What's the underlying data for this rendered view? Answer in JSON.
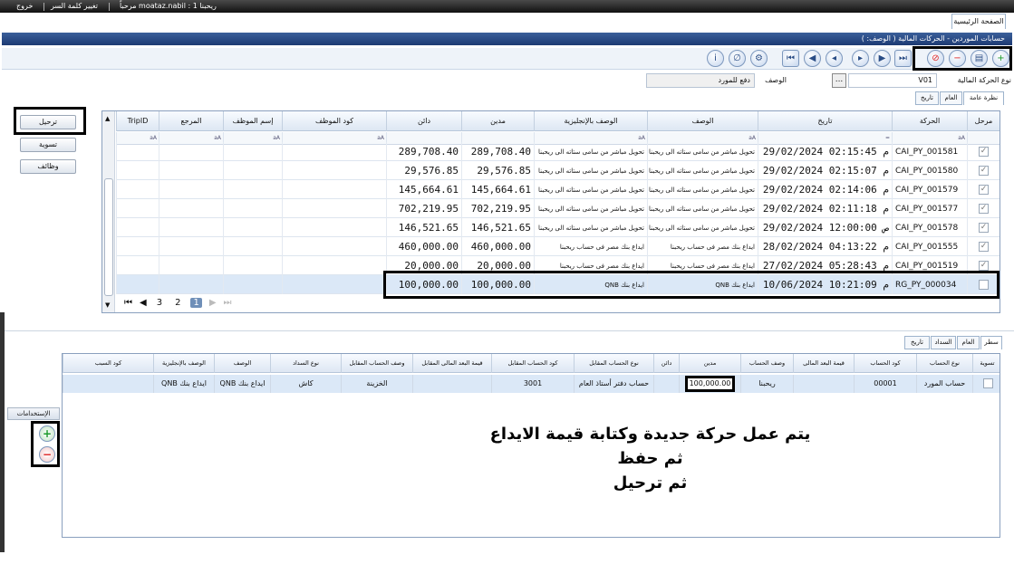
{
  "topbar": {
    "exit": "خروج",
    "change_password": "تغيير كلمة السر",
    "greeting": "مرحباً moataz.nabil : ريحبنا 1"
  },
  "tabs": {
    "home": "الصفحة الرئيسية"
  },
  "breadcrumb": "حسابات الموردين - الحركات المالية  ( الوصف: )",
  "toolbar_icons": [
    "add-icon",
    "save-icon",
    "delete-icon",
    "cancel-icon",
    "last-icon",
    "next-icon",
    "next-page-icon",
    "prev-page-icon",
    "prev-icon",
    "first-icon",
    "settings-icon",
    "attach-icon",
    "info-icon"
  ],
  "filters": {
    "movement_type_label": "نوع الحركة المالية",
    "movement_type_value": "V01",
    "description_label": "الوصف",
    "description_value": "دفع للمورد",
    "lookup_button": "..."
  },
  "subtabs_top": {
    "overview": "نظرة عامة",
    "general": "العام",
    "history": "تاريخ"
  },
  "left_buttons": {
    "post": "ترحيل",
    "settle": "تسوية",
    "functions": "وظائف"
  },
  "grid1": {
    "columns": [
      "مرحل",
      "الحركة",
      "تاريخ",
      "الوصف",
      "الوصف بالإنجليزية",
      "مدين",
      "دائن",
      "كود الموظف",
      "إسم الموظف",
      "المرجع",
      "TripID"
    ],
    "filter_glyph": "aA",
    "date_filter_glyph": "=",
    "rows": [
      {
        "posted": true,
        "code": "CAI_PY_001581",
        "date": "29/02/2024 02:15:45 م",
        "desc": "تحويل مباشر من سامى ستاته الى ريحبنا",
        "desc_en": "تحويل مباشر من سامى ستاته الى ريحبنا",
        "debit": "289,708.40",
        "credit": "289,708.40"
      },
      {
        "posted": true,
        "code": "CAI_PY_001580",
        "date": "29/02/2024 02:15:07 م",
        "desc": "تحويل مباشر من سامى ستاته الى ريحبنا",
        "desc_en": "تحويل مباشر من سامى ستاته الى ريحبنا",
        "debit": "29,576.85",
        "credit": "29,576.85"
      },
      {
        "posted": true,
        "code": "CAI_PY_001579",
        "date": "29/02/2024 02:14:06 م",
        "desc": "تحويل مباشر من سامى ستاته الى ريحبنا",
        "desc_en": "تحويل مباشر من سامى ستاته الى ريحبنا",
        "debit": "145,664.61",
        "credit": "145,664.61"
      },
      {
        "posted": true,
        "code": "CAI_PY_001577",
        "date": "29/02/2024 02:11:18 م",
        "desc": "تحويل مباشر من سامى ستاته الى ريحبنا",
        "desc_en": "تحويل مباشر من سامى ستاته الى ريحبنا",
        "debit": "702,219.95",
        "credit": "702,219.95"
      },
      {
        "posted": true,
        "code": "CAI_PY_001578",
        "date": "29/02/2024 12:00:00 ص",
        "desc": "تحويل مباشر من سامى ستاته الى ريحبنا",
        "desc_en": "تحويل مباشر من سامى ستاته الى ريحبنا",
        "debit": "146,521.65",
        "credit": "146,521.65"
      },
      {
        "posted": true,
        "code": "CAI_PY_001555",
        "date": "28/02/2024 04:13:22 م",
        "desc": "ايداع بنك مصر فى حساب ريحبنا",
        "desc_en": "ايداع بنك مصر فى حساب ريحبنا",
        "debit": "460,000.00",
        "credit": "460,000.00"
      },
      {
        "posted": true,
        "code": "CAI_PY_001519",
        "date": "27/02/2024 05:28:43 م",
        "desc": "ايداع بنك مصر فى حساب ريحبنا",
        "desc_en": "ايداع بنك مصر فى حساب ريحبنا",
        "debit": "20,000.00",
        "credit": "20,000.00"
      },
      {
        "posted": false,
        "code": "RG_PY_000034",
        "date": "10/06/2024 10:21:09 م",
        "desc": "ايداع بنك QNB",
        "desc_en": "ايداع بنك QNB",
        "debit": "100,000.00",
        "credit": "100,000.00"
      }
    ],
    "pager": {
      "first": "⏮",
      "prev": "◀",
      "pages": [
        "3",
        "2",
        "1"
      ],
      "current": "1",
      "next": "▶",
      "last": "⏭"
    }
  },
  "subtabs_bottom": {
    "lines": "سطر",
    "general": "العام",
    "payment": "السداد",
    "history": "تاريخ"
  },
  "uses": {
    "label": "الإستخدامات"
  },
  "grid2": {
    "columns": [
      "تسوية",
      "نوع الحساب",
      "كود الحساب",
      "قيمة البعد المالى",
      "وصف الحساب",
      "مدين",
      "دائن",
      "نوع الحساب المقابل",
      "كود الحساب المقابل",
      "قيمة البعد المالى المقابل",
      "وصف الحساب المقابل",
      "نوع السداد",
      "الوصف",
      "الوصف بالإنجليزية",
      "كود السبب"
    ],
    "row": {
      "account_type": "حساب المورد",
      "account_code": "00001",
      "fin_dim": "",
      "account_desc": "ريحبنا",
      "debit": "100,000.00",
      "credit": "",
      "offset_type": "حساب دفتر أستاذ العام",
      "offset_code": "3001",
      "offset_dim": "",
      "offset_desc": "الخزينة",
      "payment_type": "كاش",
      "desc": "ايداع بنك QNB",
      "desc_en": "ايداع بنك QNB",
      "reason": ""
    }
  },
  "note": {
    "line1": "يتم عمل حركة جديدة وكتابة قيمة الايداع",
    "line2": "ثم حفظ",
    "line3": "ثم ترحيل"
  }
}
